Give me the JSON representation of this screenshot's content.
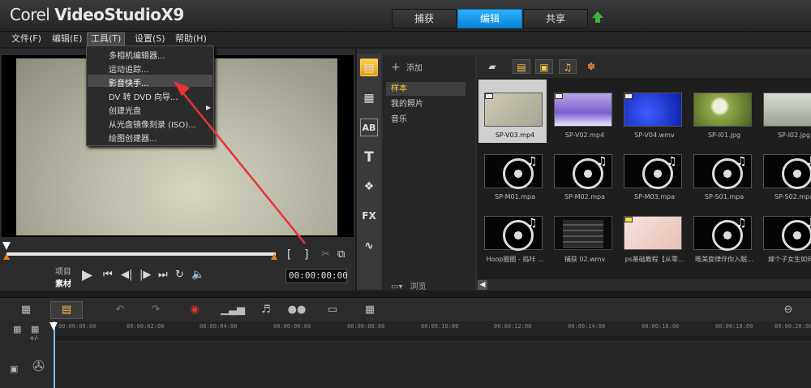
{
  "app": {
    "title_brand": "Corel",
    "title_product": "VideoStudioX9"
  },
  "steps": {
    "capture": "捕获",
    "edit": "编辑",
    "share": "共享"
  },
  "menubar": {
    "file": "文件(F)",
    "edit": "编辑(E)",
    "tools": "工具(T)",
    "settings": "设置(S)",
    "help": "帮助(H)"
  },
  "tools_menu": {
    "items": [
      "多相机编辑器...",
      "运动追踪...",
      "影音快手...",
      "DV 转 DVD 向导...",
      "创建光盘",
      "从光盘镜像刻录 (ISO)...",
      "绘图创建器..."
    ],
    "highlighted": "影音快手..."
  },
  "player": {
    "mode_project": "项目",
    "mode_clip": "素材",
    "timecode": "00:00:00:00"
  },
  "library": {
    "add_label": "添加",
    "folders": [
      "样本",
      "我的照片",
      "音乐"
    ],
    "selected_folder": "样本",
    "browse_label": "浏览",
    "thumbnails": [
      {
        "caption": "SP-V03.mp4"
      },
      {
        "caption": "SP-V02.mp4"
      },
      {
        "caption": "SP-V04.wmv"
      },
      {
        "caption": "SP-I01.jpg"
      },
      {
        "caption": "SP-I02.jpg"
      },
      {
        "caption": "SP-M01.mpa"
      },
      {
        "caption": "SP-M02.mpa"
      },
      {
        "caption": "SP-M03.mpa"
      },
      {
        "caption": "SP-S01.mpa"
      },
      {
        "caption": "SP-S02.mpa"
      },
      {
        "caption": "Hoop圈圈 - 捣咔 ..."
      },
      {
        "caption": "捕获 02.wmv"
      },
      {
        "caption": "ps基础教程【从零..."
      },
      {
        "caption": "唯美旋律伴你入眠..."
      },
      {
        "caption": "嫁个子女生如何..."
      }
    ]
  },
  "timeline": {
    "ticks": [
      "00:00:00:00",
      "00:00:02:00",
      "00:00:04:00",
      "00:00:06:00",
      "00:00:08:00",
      "00:00:10:00",
      "00:00:12:00",
      "00:00:14:00",
      "00:00:16:00",
      "00:00:18:00",
      "00:00:20:00"
    ],
    "track_toggle": "+/-"
  },
  "colors": {
    "accent_blue": "#1a9af0",
    "annotation_red": "#e8323a",
    "trim_orange": "#e77b1a"
  }
}
